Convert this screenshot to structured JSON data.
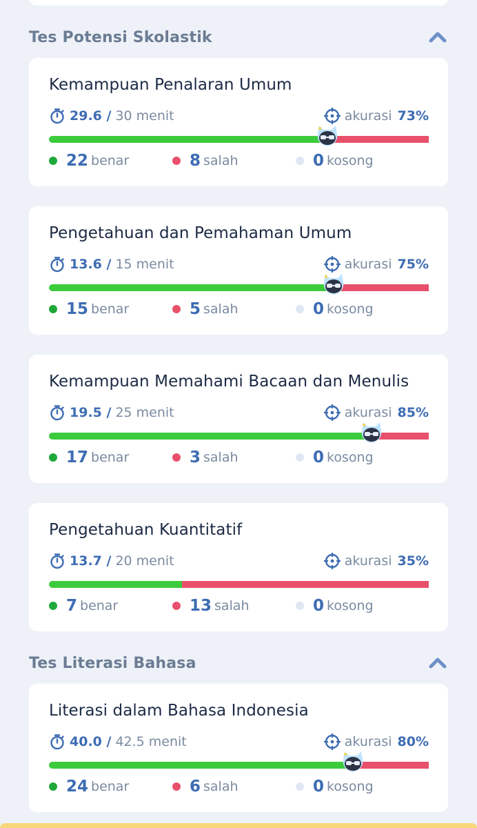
{
  "colors": {
    "correct": "#3ccb3c",
    "wrong": "#e8506b",
    "empty": "#dfe7f3",
    "accent": "#3d6cb3"
  },
  "sections": [
    {
      "title": "Tes Potensi Skolastik",
      "collapse_icon": "chevron-up-icon",
      "subtests": [
        {
          "title": "Kemampuan Penalaran Umum",
          "time_used": "29.6 /",
          "time_total": "30 menit",
          "accuracy_label": "akurasi",
          "accuracy_value": "73%",
          "correct": "22",
          "correct_label": "benar",
          "wrong": "8",
          "wrong_label": "salah",
          "empty": "0",
          "empty_label": "kosong",
          "correct_fraction": 0.733
        },
        {
          "title": "Pengetahuan dan Pemahaman Umum",
          "time_used": "13.6 /",
          "time_total": "15 menit",
          "accuracy_label": "akurasi",
          "accuracy_value": "75%",
          "correct": "15",
          "correct_label": "benar",
          "wrong": "5",
          "wrong_label": "salah",
          "empty": "0",
          "empty_label": "kosong",
          "correct_fraction": 0.75
        },
        {
          "title": "Kemampuan Memahami Bacaan dan Menulis",
          "time_used": "19.5 /",
          "time_total": "25 menit",
          "accuracy_label": "akurasi",
          "accuracy_value": "85%",
          "correct": "17",
          "correct_label": "benar",
          "wrong": "3",
          "wrong_label": "salah",
          "empty": "0",
          "empty_label": "kosong",
          "correct_fraction": 0.85
        },
        {
          "title": "Pengetahuan Kuantitatif",
          "time_used": "13.7 /",
          "time_total": "20 menit",
          "accuracy_label": "akurasi",
          "accuracy_value": "35%",
          "correct": "7",
          "correct_label": "benar",
          "wrong": "13",
          "wrong_label": "salah",
          "empty": "0",
          "empty_label": "kosong",
          "correct_fraction": 0.35
        }
      ]
    },
    {
      "title": "Tes Literasi Bahasa",
      "collapse_icon": "chevron-up-icon",
      "subtests": [
        {
          "title": "Literasi dalam Bahasa Indonesia",
          "time_used": "40.0 /",
          "time_total": "42.5 menit",
          "accuracy_label": "akurasi",
          "accuracy_value": "80%",
          "correct": "24",
          "correct_label": "benar",
          "wrong": "6",
          "wrong_label": "salah",
          "empty": "0",
          "empty_label": "kosong",
          "correct_fraction": 0.8
        }
      ]
    }
  ]
}
